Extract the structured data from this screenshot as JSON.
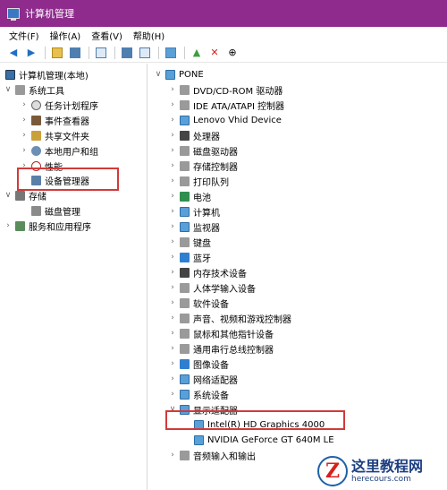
{
  "window": {
    "title": "计算机管理"
  },
  "menu": [
    "文件(F)",
    "操作(A)",
    "查看(V)",
    "帮助(H)"
  ],
  "left_tree": {
    "root": "计算机管理(本地)",
    "system_tools": "系统工具",
    "task_scheduler": "任务计划程序",
    "event_viewer": "事件查看器",
    "shared_folders": "共享文件夹",
    "local_users": "本地用户和组",
    "performance": "性能",
    "device_manager": "设备管理器",
    "storage": "存储",
    "disk_management": "磁盘管理",
    "services": "服务和应用程序"
  },
  "right_tree": {
    "root": "PONE",
    "items": [
      "DVD/CD-ROM 驱动器",
      "IDE ATA/ATAPI 控制器",
      "Lenovo Vhid Device",
      "处理器",
      "磁盘驱动器",
      "存储控制器",
      "打印队列",
      "电池",
      "计算机",
      "监视器",
      "键盘",
      "蓝牙",
      "内存技术设备",
      "人体学输入设备",
      "软件设备",
      "声音、视频和游戏控制器",
      "鼠标和其他指针设备",
      "通用串行总线控制器",
      "图像设备",
      "网络适配器",
      "系统设备",
      "显示适配器"
    ],
    "display_children": [
      "Intel(R) HD Graphics 4000",
      "NVIDIA GeForce GT 640M LE"
    ],
    "last_item": "音频输入和输出"
  },
  "watermark": {
    "logo": "Z",
    "title": "这里教程网",
    "url": "herecours.com"
  }
}
